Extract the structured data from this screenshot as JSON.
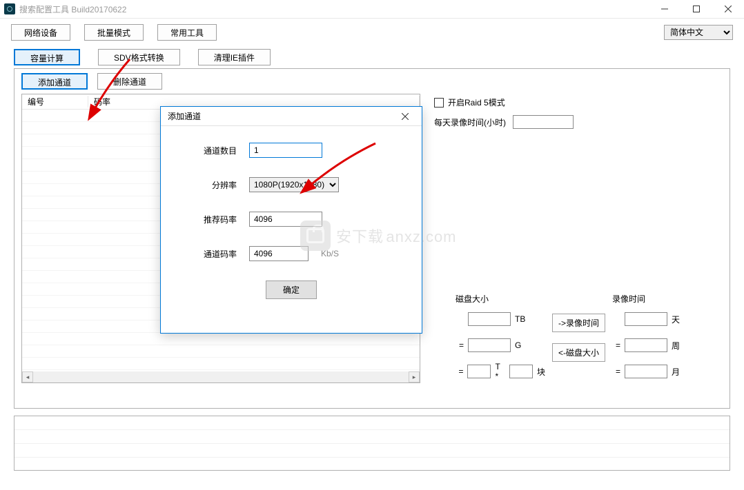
{
  "titlebar": {
    "title": "搜索配置工具 Build20170622"
  },
  "toolbar": {
    "network": "网络设备",
    "batch": "批量模式",
    "tools": "常用工具",
    "lang": "简体中文"
  },
  "tabs": {
    "capacity": "容量计算",
    "sdv": "SDV格式转换",
    "cleanie": "清理IE插件"
  },
  "channels": {
    "add": "添加通道",
    "del": "删除通道"
  },
  "table": {
    "col_no": "编号",
    "col_rate": "码率"
  },
  "right": {
    "raid": "开启Raid 5模式",
    "rec_per_day": "每天录像时间(小时)"
  },
  "calc": {
    "disk_title": "磁盘大小",
    "rec_title": "录像时间",
    "tb": "TB",
    "g": "G",
    "t_star": "T *",
    "kuai": "块",
    "day": "天",
    "week": "周",
    "month": "月",
    "to_rec": "->录像时间",
    "to_disk": "<-磁盘大小",
    "eq": "="
  },
  "dialog": {
    "title": "添加通道",
    "ch_count_label": "通道数目",
    "ch_count": "1",
    "res_label": "分辨率",
    "res": "1080P(1920x1080)",
    "rec_rate_label": "推荐码率",
    "rec_rate": "4096",
    "ch_rate_label": "通道码率",
    "ch_rate": "4096",
    "ch_rate_unit": "Kb/S",
    "ok": "确定"
  },
  "watermark": {
    "cn": "安下载",
    "en": "anxz.com"
  }
}
